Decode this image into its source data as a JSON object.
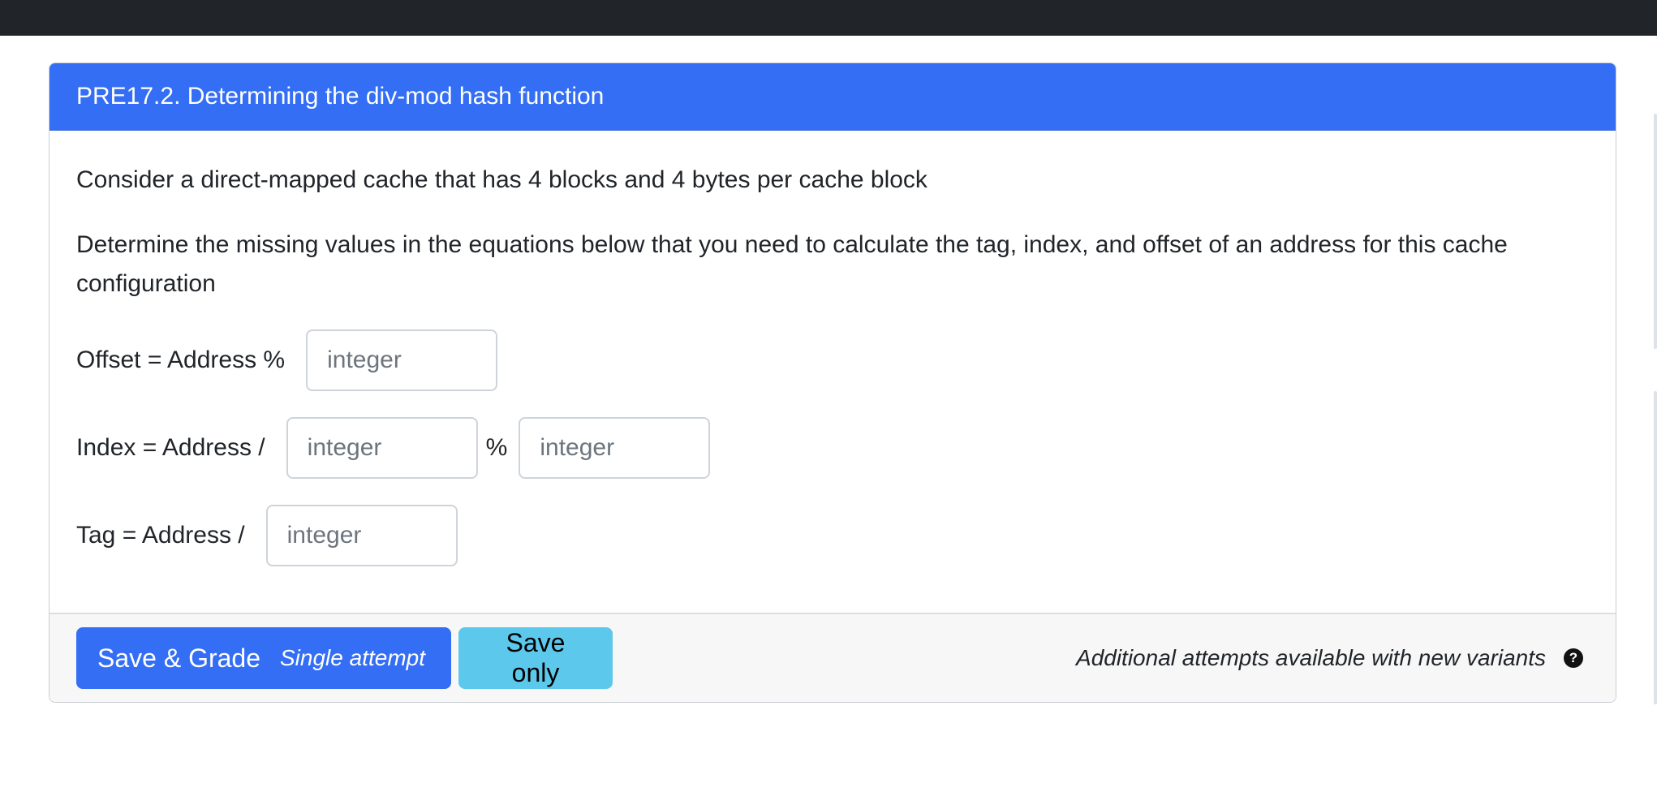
{
  "question": {
    "title": "PRE17.2. Determining the div-mod hash function",
    "intro": "Consider a direct-mapped cache that has 4 blocks and 4 bytes per cache block",
    "instructions": "Determine the missing values in the equations below that you need to calculate the tag, index, and offset of an address for this cache configuration",
    "equations": {
      "offset_label": "Offset = Address %",
      "index_label": "Index = Address /",
      "index_mod_symbol": "%",
      "tag_label": "Tag = Address /",
      "placeholder": "integer",
      "values": {
        "offset_mod": "",
        "index_div": "",
        "index_mod": "",
        "tag_div": ""
      }
    }
  },
  "footer": {
    "save_grade_label": "Save & Grade",
    "save_grade_sub": "Single attempt",
    "save_only_label": "Save only",
    "note": "Additional attempts available with new variants",
    "help_icon": "question-circle-icon",
    "help_glyph": "?"
  },
  "colors": {
    "header_bg": "#336ef5",
    "primary_button": "#336ef5",
    "info_button": "#5cc8ec",
    "topbar": "#212428"
  }
}
